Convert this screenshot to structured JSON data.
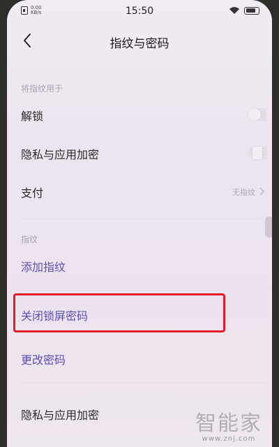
{
  "status_bar": {
    "speed_value": "0.00",
    "speed_unit": "KB/s",
    "time": "15:50",
    "battery_level": 0.85
  },
  "header": {
    "title": "指纹与密码"
  },
  "section_use": {
    "label": "将指纹用于",
    "items": [
      {
        "label": "解锁",
        "toggle": "on"
      },
      {
        "label": "隐私与应用加密",
        "toggle": "off"
      },
      {
        "label": "支付",
        "value": "无指纹"
      }
    ]
  },
  "section_fingerprint": {
    "label": "指纹",
    "items": [
      {
        "label": "添加指纹"
      }
    ]
  },
  "password_items": [
    {
      "label": "关闭锁屏密码"
    },
    {
      "label": "更改密码"
    }
  ],
  "bottom_item": {
    "label": "隐私与应用加密"
  },
  "watermark": {
    "main": "智能家",
    "url": "www.znj.com"
  },
  "colors": {
    "link": "#5a4fb6",
    "highlight": "#e01e2a",
    "background": "#ede5ef"
  }
}
